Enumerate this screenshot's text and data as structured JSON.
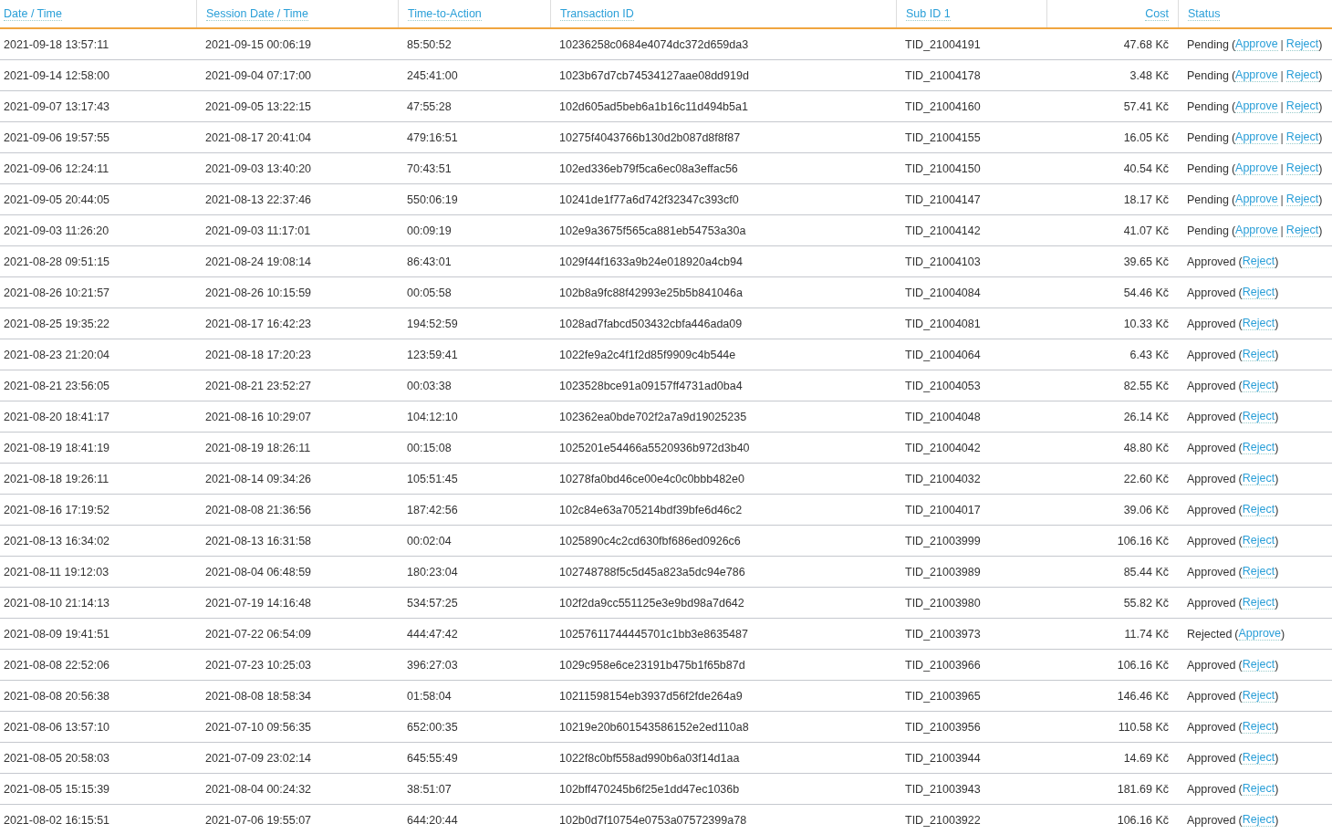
{
  "table": {
    "columns": [
      "Date / Time",
      "Session Date / Time",
      "Time-to-Action",
      "Transaction ID",
      "Sub ID 1",
      "Cost",
      "Status"
    ],
    "status_punctuation": {
      "open": "(",
      "separator": "|",
      "close": ")"
    },
    "rows": [
      {
        "date": "2021-09-18 13:57:11",
        "session": "2021-09-15 00:06:19",
        "tta": "85:50:52",
        "txid": "10236258c0684e4074dc372d659da3",
        "subid": "TID_21004191",
        "cost": "47.68 Kč",
        "status": "Pending",
        "actions": [
          "Approve",
          "Reject"
        ]
      },
      {
        "date": "2021-09-14 12:58:00",
        "session": "2021-09-04 07:17:00",
        "tta": "245:41:00",
        "txid": "1023b67d7cb74534127aae08dd919d",
        "subid": "TID_21004178",
        "cost": "3.48 Kč",
        "status": "Pending",
        "actions": [
          "Approve",
          "Reject"
        ]
      },
      {
        "date": "2021-09-07 13:17:43",
        "session": "2021-09-05 13:22:15",
        "tta": "47:55:28",
        "txid": "102d605ad5beb6a1b16c11d494b5a1",
        "subid": "TID_21004160",
        "cost": "57.41 Kč",
        "status": "Pending",
        "actions": [
          "Approve",
          "Reject"
        ]
      },
      {
        "date": "2021-09-06 19:57:55",
        "session": "2021-08-17 20:41:04",
        "tta": "479:16:51",
        "txid": "10275f4043766b130d2b087d8f8f87",
        "subid": "TID_21004155",
        "cost": "16.05 Kč",
        "status": "Pending",
        "actions": [
          "Approve",
          "Reject"
        ]
      },
      {
        "date": "2021-09-06 12:24:11",
        "session": "2021-09-03 13:40:20",
        "tta": "70:43:51",
        "txid": "102ed336eb79f5ca6ec08a3effac56",
        "subid": "TID_21004150",
        "cost": "40.54 Kč",
        "status": "Pending",
        "actions": [
          "Approve",
          "Reject"
        ]
      },
      {
        "date": "2021-09-05 20:44:05",
        "session": "2021-08-13 22:37:46",
        "tta": "550:06:19",
        "txid": "10241de1f77a6d742f32347c393cf0",
        "subid": "TID_21004147",
        "cost": "18.17 Kč",
        "status": "Pending",
        "actions": [
          "Approve",
          "Reject"
        ]
      },
      {
        "date": "2021-09-03 11:26:20",
        "session": "2021-09-03 11:17:01",
        "tta": "00:09:19",
        "txid": "102e9a3675f565ca881eb54753a30a",
        "subid": "TID_21004142",
        "cost": "41.07 Kč",
        "status": "Pending",
        "actions": [
          "Approve",
          "Reject"
        ]
      },
      {
        "date": "2021-08-28 09:51:15",
        "session": "2021-08-24 19:08:14",
        "tta": "86:43:01",
        "txid": "1029f44f1633a9b24e018920a4cb94",
        "subid": "TID_21004103",
        "cost": "39.65 Kč",
        "status": "Approved",
        "actions": [
          "Reject"
        ]
      },
      {
        "date": "2021-08-26 10:21:57",
        "session": "2021-08-26 10:15:59",
        "tta": "00:05:58",
        "txid": "102b8a9fc88f42993e25b5b841046a",
        "subid": "TID_21004084",
        "cost": "54.46 Kč",
        "status": "Approved",
        "actions": [
          "Reject"
        ]
      },
      {
        "date": "2021-08-25 19:35:22",
        "session": "2021-08-17 16:42:23",
        "tta": "194:52:59",
        "txid": "1028ad7fabcd503432cbfa446ada09",
        "subid": "TID_21004081",
        "cost": "10.33 Kč",
        "status": "Approved",
        "actions": [
          "Reject"
        ]
      },
      {
        "date": "2021-08-23 21:20:04",
        "session": "2021-08-18 17:20:23",
        "tta": "123:59:41",
        "txid": "1022fe9a2c4f1f2d85f9909c4b544e",
        "subid": "TID_21004064",
        "cost": "6.43 Kč",
        "status": "Approved",
        "actions": [
          "Reject"
        ]
      },
      {
        "date": "2021-08-21 23:56:05",
        "session": "2021-08-21 23:52:27",
        "tta": "00:03:38",
        "txid": "1023528bce91a09157ff4731ad0ba4",
        "subid": "TID_21004053",
        "cost": "82.55 Kč",
        "status": "Approved",
        "actions": [
          "Reject"
        ]
      },
      {
        "date": "2021-08-20 18:41:17",
        "session": "2021-08-16 10:29:07",
        "tta": "104:12:10",
        "txid": "102362ea0bde702f2a7a9d19025235",
        "subid": "TID_21004048",
        "cost": "26.14 Kč",
        "status": "Approved",
        "actions": [
          "Reject"
        ]
      },
      {
        "date": "2021-08-19 18:41:19",
        "session": "2021-08-19 18:26:11",
        "tta": "00:15:08",
        "txid": "1025201e54466a5520936b972d3b40",
        "subid": "TID_21004042",
        "cost": "48.80 Kč",
        "status": "Approved",
        "actions": [
          "Reject"
        ]
      },
      {
        "date": "2021-08-18 19:26:11",
        "session": "2021-08-14 09:34:26",
        "tta": "105:51:45",
        "txid": "10278fa0bd46ce00e4c0c0bbb482e0",
        "subid": "TID_21004032",
        "cost": "22.60 Kč",
        "status": "Approved",
        "actions": [
          "Reject"
        ]
      },
      {
        "date": "2021-08-16 17:19:52",
        "session": "2021-08-08 21:36:56",
        "tta": "187:42:56",
        "txid": "102c84e63a705214bdf39bfe6d46c2",
        "subid": "TID_21004017",
        "cost": "39.06 Kč",
        "status": "Approved",
        "actions": [
          "Reject"
        ]
      },
      {
        "date": "2021-08-13 16:34:02",
        "session": "2021-08-13 16:31:58",
        "tta": "00:02:04",
        "txid": "1025890c4c2cd630fbf686ed0926c6",
        "subid": "TID_21003999",
        "cost": "106.16 Kč",
        "status": "Approved",
        "actions": [
          "Reject"
        ]
      },
      {
        "date": "2021-08-11 19:12:03",
        "session": "2021-08-04 06:48:59",
        "tta": "180:23:04",
        "txid": "102748788f5c5d45a823a5dc94e786",
        "subid": "TID_21003989",
        "cost": "85.44 Kč",
        "status": "Approved",
        "actions": [
          "Reject"
        ]
      },
      {
        "date": "2021-08-10 21:14:13",
        "session": "2021-07-19 14:16:48",
        "tta": "534:57:25",
        "txid": "102f2da9cc551125e3e9bd98a7d642",
        "subid": "TID_21003980",
        "cost": "55.82 Kč",
        "status": "Approved",
        "actions": [
          "Reject"
        ]
      },
      {
        "date": "2021-08-09 19:41:51",
        "session": "2021-07-22 06:54:09",
        "tta": "444:47:42",
        "txid": "10257611744445701c1bb3e8635487",
        "subid": "TID_21003973",
        "cost": "11.74 Kč",
        "status": "Rejected",
        "actions": [
          "Approve"
        ]
      },
      {
        "date": "2021-08-08 22:52:06",
        "session": "2021-07-23 10:25:03",
        "tta": "396:27:03",
        "txid": "1029c958e6ce23191b475b1f65b87d",
        "subid": "TID_21003966",
        "cost": "106.16 Kč",
        "status": "Approved",
        "actions": [
          "Reject"
        ]
      },
      {
        "date": "2021-08-08 20:56:38",
        "session": "2021-08-08 18:58:34",
        "tta": "01:58:04",
        "txid": "10211598154eb3937d56f2fde264a9",
        "subid": "TID_21003965",
        "cost": "146.46 Kč",
        "status": "Approved",
        "actions": [
          "Reject"
        ]
      },
      {
        "date": "2021-08-06 13:57:10",
        "session": "2021-07-10 09:56:35",
        "tta": "652:00:35",
        "txid": "10219e20b601543586152e2ed110a8",
        "subid": "TID_21003956",
        "cost": "110.58 Kč",
        "status": "Approved",
        "actions": [
          "Reject"
        ]
      },
      {
        "date": "2021-08-05 20:58:03",
        "session": "2021-07-09 23:02:14",
        "tta": "645:55:49",
        "txid": "1022f8c0bf558ad990b6a03f14d1aa",
        "subid": "TID_21003944",
        "cost": "14.69 Kč",
        "status": "Approved",
        "actions": [
          "Reject"
        ]
      },
      {
        "date": "2021-08-05 15:15:39",
        "session": "2021-08-04 00:24:32",
        "tta": "38:51:07",
        "txid": "102bff470245b6f25e1dd47ec1036b",
        "subid": "TID_21003943",
        "cost": "181.69 Kč",
        "status": "Approved",
        "actions": [
          "Reject"
        ]
      },
      {
        "date": "2021-08-02 16:15:51",
        "session": "2021-07-06 19:55:07",
        "tta": "644:20:44",
        "txid": "102b0d7f10754e0753a07572399a78",
        "subid": "TID_21003922",
        "cost": "106.16 Kč",
        "status": "Approved",
        "actions": [
          "Reject"
        ]
      }
    ]
  }
}
